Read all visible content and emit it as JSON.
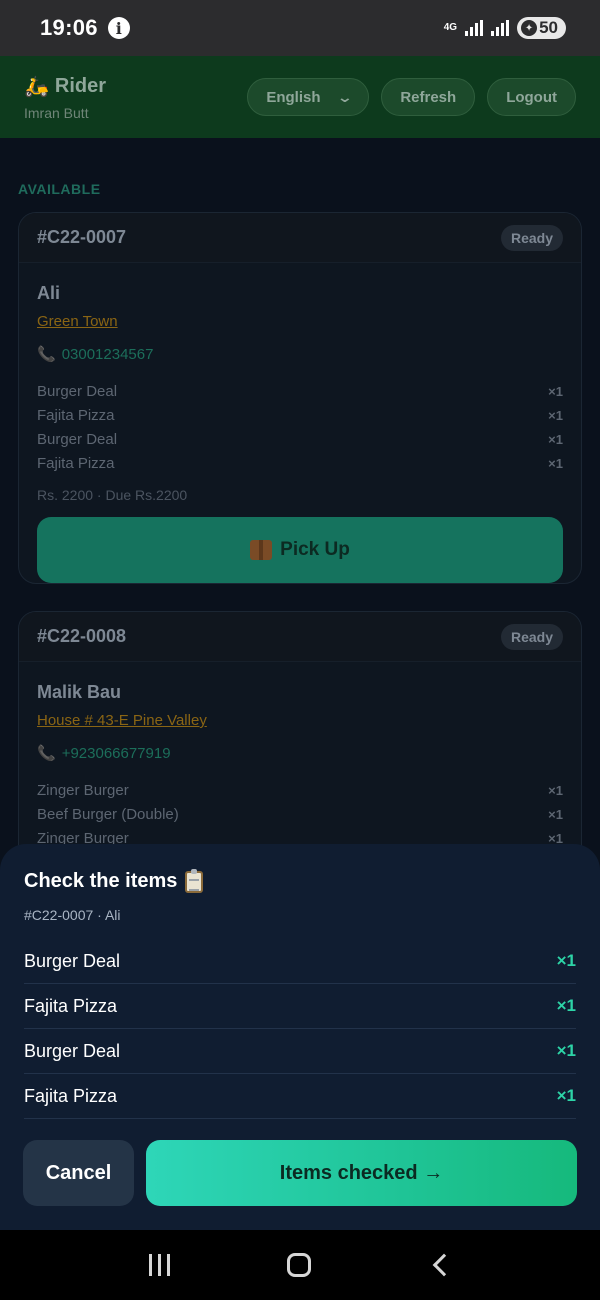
{
  "status_bar": {
    "time": "19:06",
    "network": "4G",
    "battery": "50"
  },
  "header": {
    "title": "Rider",
    "rider_icon": "scooter-icon",
    "subtitle": "Imran Butt",
    "language": "English",
    "refresh_label": "Refresh",
    "logout_label": "Logout"
  },
  "section_label": "AVAILABLE",
  "orders": [
    {
      "id": "#C22-0007",
      "status": "Ready",
      "customer": "Ali",
      "address": "Green Town",
      "phone": "03001234567",
      "items": [
        {
          "name": "Burger Deal",
          "qty": "×1"
        },
        {
          "name": "Fajita Pizza",
          "qty": "×1"
        },
        {
          "name": "Burger Deal",
          "qty": "×1"
        },
        {
          "name": "Fajita Pizza",
          "qty": "×1"
        }
      ],
      "total": "Rs. 2200 · Due Rs.2200",
      "action_label": "Pick Up"
    },
    {
      "id": "#C22-0008",
      "status": "Ready",
      "customer": "Malik Bau",
      "address": "House # 43-E Pine Valley",
      "phone": "+923066677919",
      "items": [
        {
          "name": "Zinger Burger",
          "qty": "×1"
        },
        {
          "name": "Beef Burger (Double)",
          "qty": "×1"
        },
        {
          "name": "Zinger Burger",
          "qty": "×1"
        }
      ]
    }
  ],
  "sheet": {
    "title": "Check the items",
    "subtitle": "#C22-0007 · Ali",
    "items": [
      {
        "name": "Burger Deal",
        "qty": "×1"
      },
      {
        "name": "Fajita Pizza",
        "qty": "×1"
      },
      {
        "name": "Burger Deal",
        "qty": "×1"
      },
      {
        "name": "Fajita Pizza",
        "qty": "×1"
      }
    ],
    "cancel_label": "Cancel",
    "confirm_label": "Items checked →"
  },
  "colors": {
    "accent": "#2dd4a7",
    "header_bg": "#0d3a1d",
    "sheet_bg": "#101d31"
  }
}
